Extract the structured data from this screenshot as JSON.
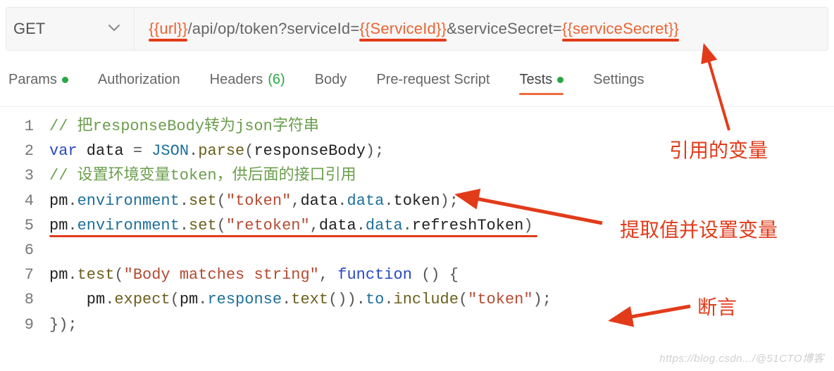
{
  "request": {
    "method": "GET",
    "url_parts": {
      "var_url": "{{url}}",
      "seg1": "/api/op/token?serviceId=",
      "var_serviceId": "{{ServiceId}}",
      "seg2": "&serviceSecret=",
      "var_serviceSecret": "{{serviceSecret}}"
    }
  },
  "tabs": {
    "params": "Params",
    "authorization": "Authorization",
    "headers_label": "Headers",
    "headers_count": "(6)",
    "body": "Body",
    "prerequest": "Pre-request Script",
    "tests": "Tests",
    "settings": "Settings"
  },
  "code": {
    "lines": [
      "// 把responseBody转为json字符串",
      "var data = JSON.parse(responseBody);",
      "// 设置环境变量token，供后面的接口引用",
      "pm.environment.set(\"token\",data.data.token);",
      "pm.environment.set(\"retoken\",data.data.refreshToken)",
      "",
      "pm.test(\"Body matches string\", function () {",
      "    pm.expect(pm.response.text()).to.include(\"token\");",
      "});"
    ]
  },
  "annotations": {
    "a1": "引用的变量",
    "a2": "提取值并设置变量",
    "a3": "断言"
  },
  "watermark": "https://blog.csdn.../@51CTO博客"
}
